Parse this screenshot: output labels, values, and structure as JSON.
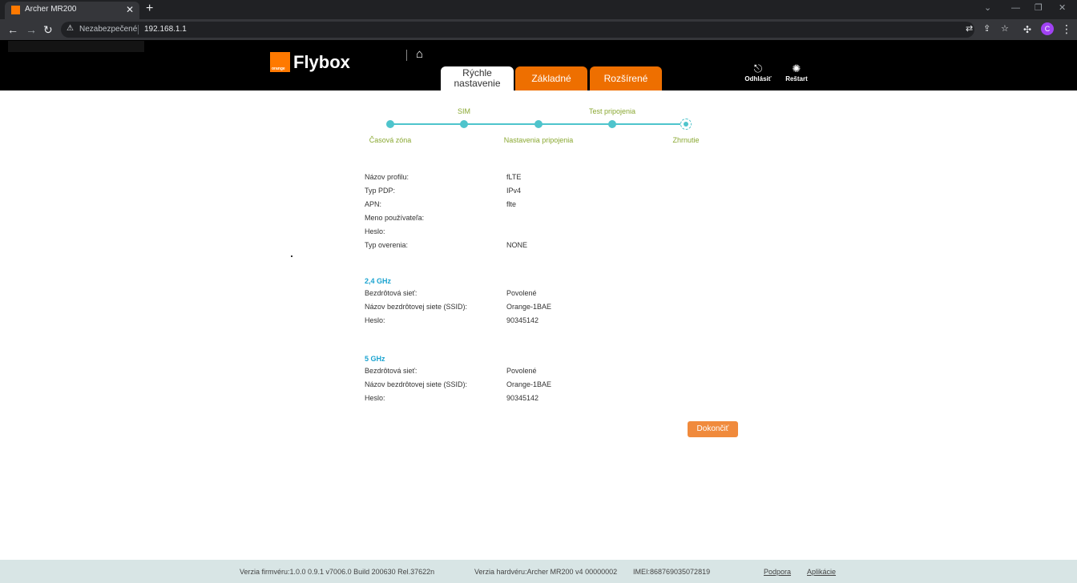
{
  "browser": {
    "tab_title": "Archer MR200",
    "tab_close": "✕",
    "new_tab": "+",
    "security_label": "Nezabezpečené",
    "url": "192.168.1.1",
    "profile_initial": "C"
  },
  "header": {
    "brand_badge": "orange",
    "brand_name": "Flybox",
    "tabs": [
      {
        "label_line1": "Rýchle",
        "label_line2": "nastavenie"
      },
      {
        "label": "Základné"
      },
      {
        "label": "Rozšírené"
      }
    ],
    "logout_label": "Odhlásiť",
    "restart_label": "Reštart"
  },
  "stepper": {
    "steps": [
      "Časová zóna",
      "SIM",
      "Nastavenia pripojenia",
      "Test pripojenia",
      "Zhrnutie"
    ],
    "current_step": 5
  },
  "summary": {
    "profile": [
      {
        "key": "Názov profilu:",
        "value": "fLTE"
      },
      {
        "key": "Typ PDP:",
        "value": "IPv4"
      },
      {
        "key": "APN:",
        "value": "flte"
      },
      {
        "key": "Meno používateľa:",
        "value": ""
      },
      {
        "key": "Heslo:",
        "value": ""
      },
      {
        "key": "Typ overenia:",
        "value": "NONE"
      }
    ],
    "band24": {
      "title": "2,4 GHz",
      "rows": [
        {
          "key": "Bezdrôtová sieť:",
          "value": "Povolené"
        },
        {
          "key": "Názov bezdrôtovej siete (SSID):",
          "value": "Orange-1BAE"
        },
        {
          "key": "Heslo:",
          "value": "90345142"
        }
      ]
    },
    "band5": {
      "title": "5 GHz",
      "rows": [
        {
          "key": "Bezdrôtová sieť:",
          "value": "Povolené"
        },
        {
          "key": "Názov bezdrôtovej siete (SSID):",
          "value": "Orange-1BAE"
        },
        {
          "key": "Heslo:",
          "value": "90345142"
        }
      ]
    },
    "finish_label": "Dokončiť"
  },
  "footer": {
    "firmware": "Verzia firmvéru:1.0.0 0.9.1 v7006.0 Build 200630 Rel.37622n",
    "hardware": "Verzia hardvéru:Archer MR200 v4 00000002",
    "imei": "IMEI:868769035072819",
    "support": "Podpora",
    "apps": "Aplikácie"
  },
  "colors": {
    "accent_orange": "#ee6f00",
    "button_orange": "#f08a3c",
    "stepper_teal": "#4ec4cc",
    "step_label_green": "#8aa832",
    "section_blue": "#1aa3d0",
    "footer_bg": "#d8e5e5"
  }
}
